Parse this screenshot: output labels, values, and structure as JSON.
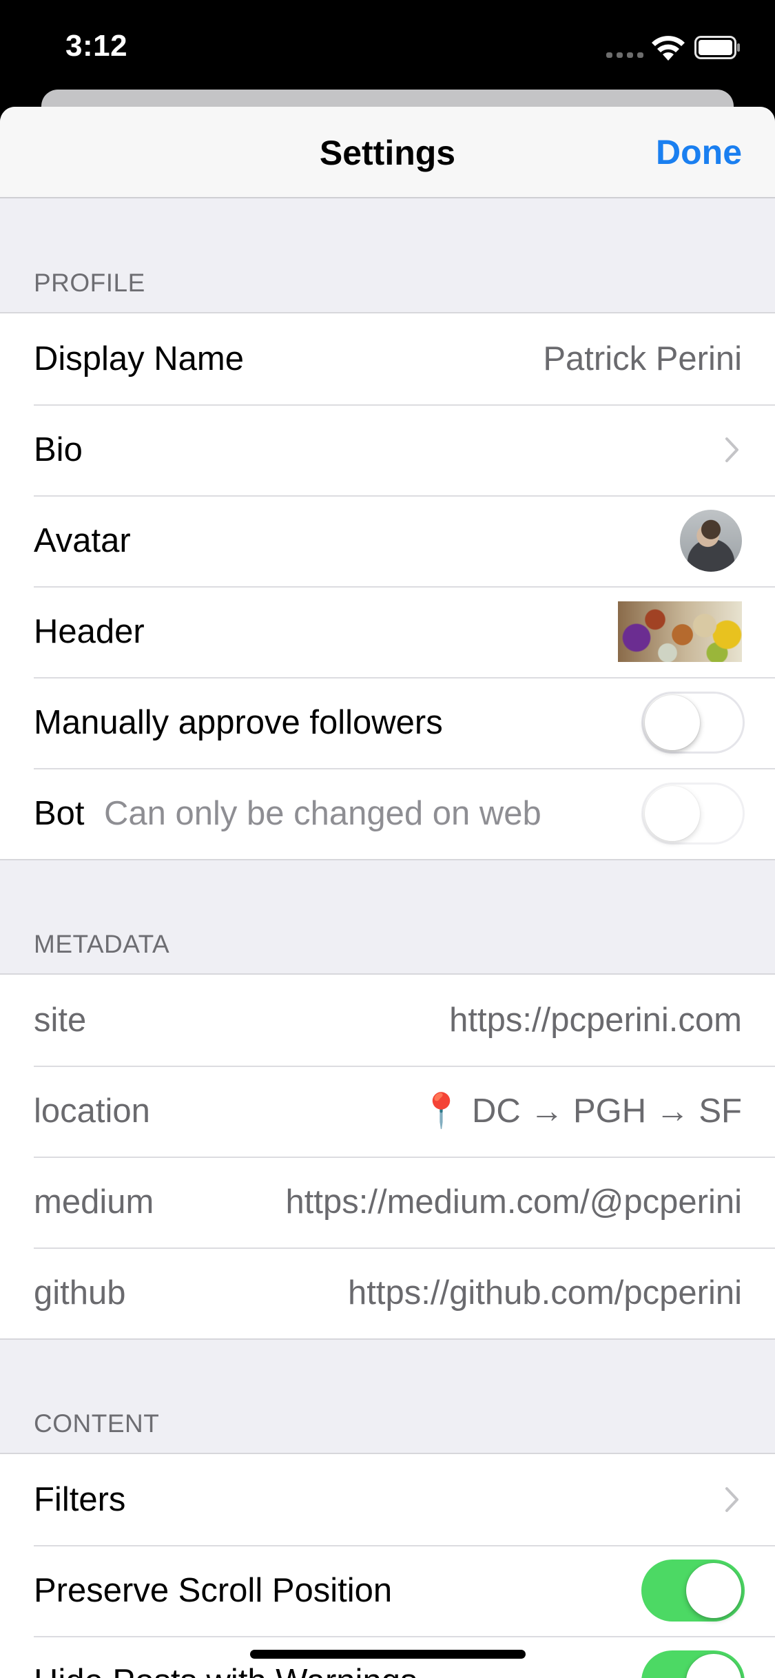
{
  "status_bar": {
    "time": "3:12"
  },
  "nav": {
    "title": "Settings",
    "done_label": "Done"
  },
  "profile": {
    "header": "PROFILE",
    "display_name_label": "Display Name",
    "display_name_value": "Patrick Perini",
    "bio_label": "Bio",
    "avatar_label": "Avatar",
    "header_label": "Header",
    "manually_approve_label": "Manually approve followers",
    "manually_approve_on": false,
    "bot_label": "Bot",
    "bot_note": "Can only be changed on web",
    "bot_on": false
  },
  "metadata": {
    "header": "METADATA",
    "fields": [
      {
        "name": "site",
        "value": "https://pcperini.com"
      },
      {
        "name": "location",
        "value": "📍 DC → PGH → SF"
      },
      {
        "name": "medium",
        "value": "https://medium.com/@pcperini"
      },
      {
        "name": "github",
        "value": "https://github.com/pcperini"
      }
    ]
  },
  "content": {
    "header": "CONTENT",
    "filters_label": "Filters",
    "preserve_scroll_label": "Preserve Scroll Position",
    "preserve_scroll_on": true,
    "hide_warnings_label": "Hide Posts with Warnings",
    "hide_warnings_on": true
  },
  "colors": {
    "accent": "#1a7ff0",
    "toggle_on": "#4cd964",
    "group_bg": "#efeff4"
  }
}
